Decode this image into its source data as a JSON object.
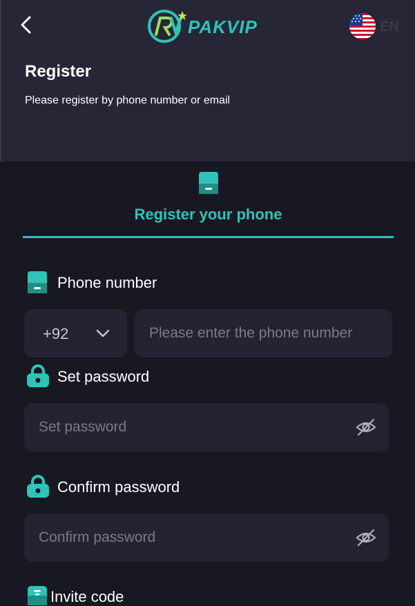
{
  "header": {
    "logo_text": "PAKVIP",
    "language": "EN",
    "title": "Register",
    "subtitle": "Please register by phone number or email"
  },
  "tab": {
    "label": "Register your phone"
  },
  "form": {
    "phone": {
      "label": "Phone number",
      "country_code": "+92",
      "placeholder": "Please enter the phone number"
    },
    "password": {
      "label": "Set password",
      "placeholder": "Set password"
    },
    "confirm": {
      "label": "Confirm password",
      "placeholder": "Confirm password"
    },
    "invite": {
      "label": "Invite code"
    }
  },
  "colors": {
    "accent": "#2fc4b7",
    "header_bg": "#262637",
    "page_bg": "#181823",
    "input_bg": "#232332"
  }
}
